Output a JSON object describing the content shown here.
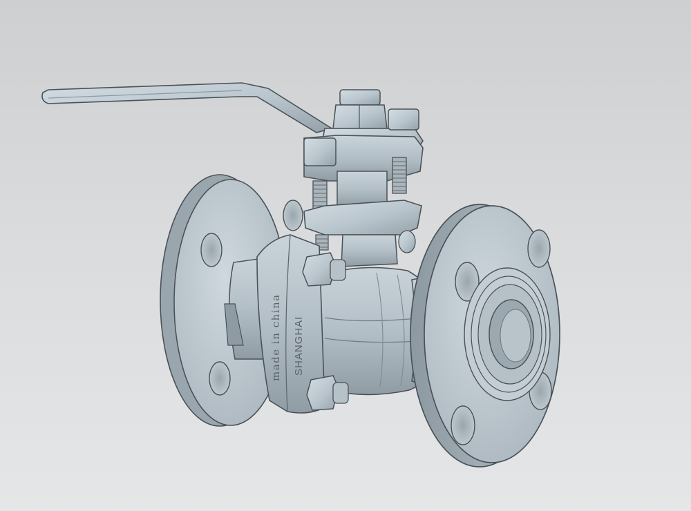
{
  "model": {
    "name": "flanged-ball-valve",
    "markings": {
      "origin": "made in china",
      "brand": "SHANGHAI"
    }
  },
  "colors": {
    "background": "#d8dadc",
    "metal": "#b9c5cd",
    "metal_shadow": "#8e9aa2",
    "outline": "#4a5257"
  }
}
